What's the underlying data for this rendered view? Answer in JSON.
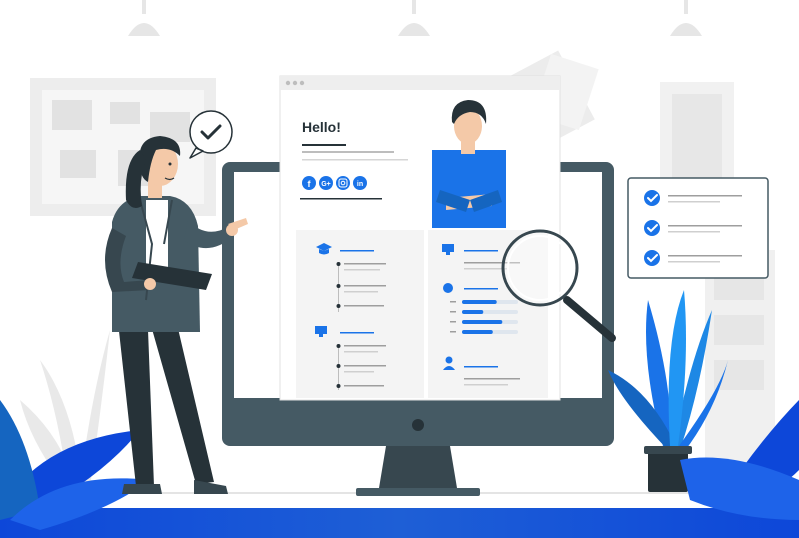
{
  "illustration": {
    "subject": "resume-review",
    "colors": {
      "accent": "#1a73e8",
      "dark": "#37474f",
      "monitor": "#455a64",
      "background_gray": "#ececec",
      "light_panel": "#f4f4f4"
    }
  },
  "resume": {
    "greeting": "Hello!",
    "social_icons": [
      "facebook-icon",
      "google-plus-icon",
      "instagram-icon",
      "linkedin-icon"
    ],
    "skill_levels": [
      0.62,
      0.38,
      0.72,
      0.55
    ]
  },
  "checklist": {
    "checked_items": 3
  }
}
